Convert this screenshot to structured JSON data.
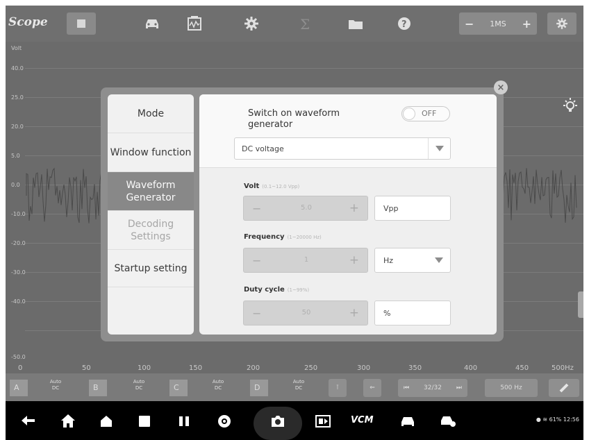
{
  "toolbar": {
    "title": "Scope",
    "icons": [
      "stop-icon",
      "vehicle-icon",
      "waveform-library-icon",
      "settings-gear-icon",
      "math-sigma-icon",
      "folder-icon",
      "help-icon"
    ],
    "time_base": "1MS",
    "minus": "−",
    "plus": "+"
  },
  "wave_area": {
    "y_labels": [
      "Volt",
      "40.0",
      "25.0",
      "20.0",
      "5.0",
      "0.0",
      "-10.0",
      "-20.0",
      "-30.0",
      "-40.0",
      "-50.0"
    ],
    "x_labels": [
      "0",
      "50",
      "100",
      "150",
      "200",
      "250",
      "300",
      "350",
      "400",
      "450",
      "500Hz"
    ]
  },
  "channel_bar": {
    "channels": [
      {
        "id": "A",
        "mode": "Auto",
        "coupling": "DC"
      },
      {
        "id": "B",
        "mode": "Auto",
        "coupling": "DC"
      },
      {
        "id": "C",
        "mode": "Auto",
        "coupling": "DC"
      },
      {
        "id": "D",
        "mode": "Auto",
        "coupling": "DC"
      }
    ],
    "page": "32/32",
    "frequency": "500 Hz"
  },
  "dialog": {
    "close": "×",
    "menu": [
      {
        "label": "Mode"
      },
      {
        "label": "Window function"
      },
      {
        "label": "Waveform Generator"
      },
      {
        "label": "Decoding Settings"
      },
      {
        "label": "Startup setting"
      }
    ],
    "switch_label": "Switch on waveform generator",
    "toggle_state": "OFF",
    "waveform_type": "DC voltage",
    "volt": {
      "label": "Volt",
      "range": "(0.1~12.0 Vpp)",
      "value": "5.0",
      "unit": "Vpp"
    },
    "frequency": {
      "label": "Frequency",
      "range": "(1~20000 Hz)",
      "value": "1",
      "unit": "Hz"
    },
    "duty_cycle": {
      "label": "Duty cycle",
      "range": "(1~99%)",
      "value": "50",
      "unit": "%"
    }
  },
  "nav": {
    "vcm_label": "VCM",
    "status": "61% 12:56"
  }
}
